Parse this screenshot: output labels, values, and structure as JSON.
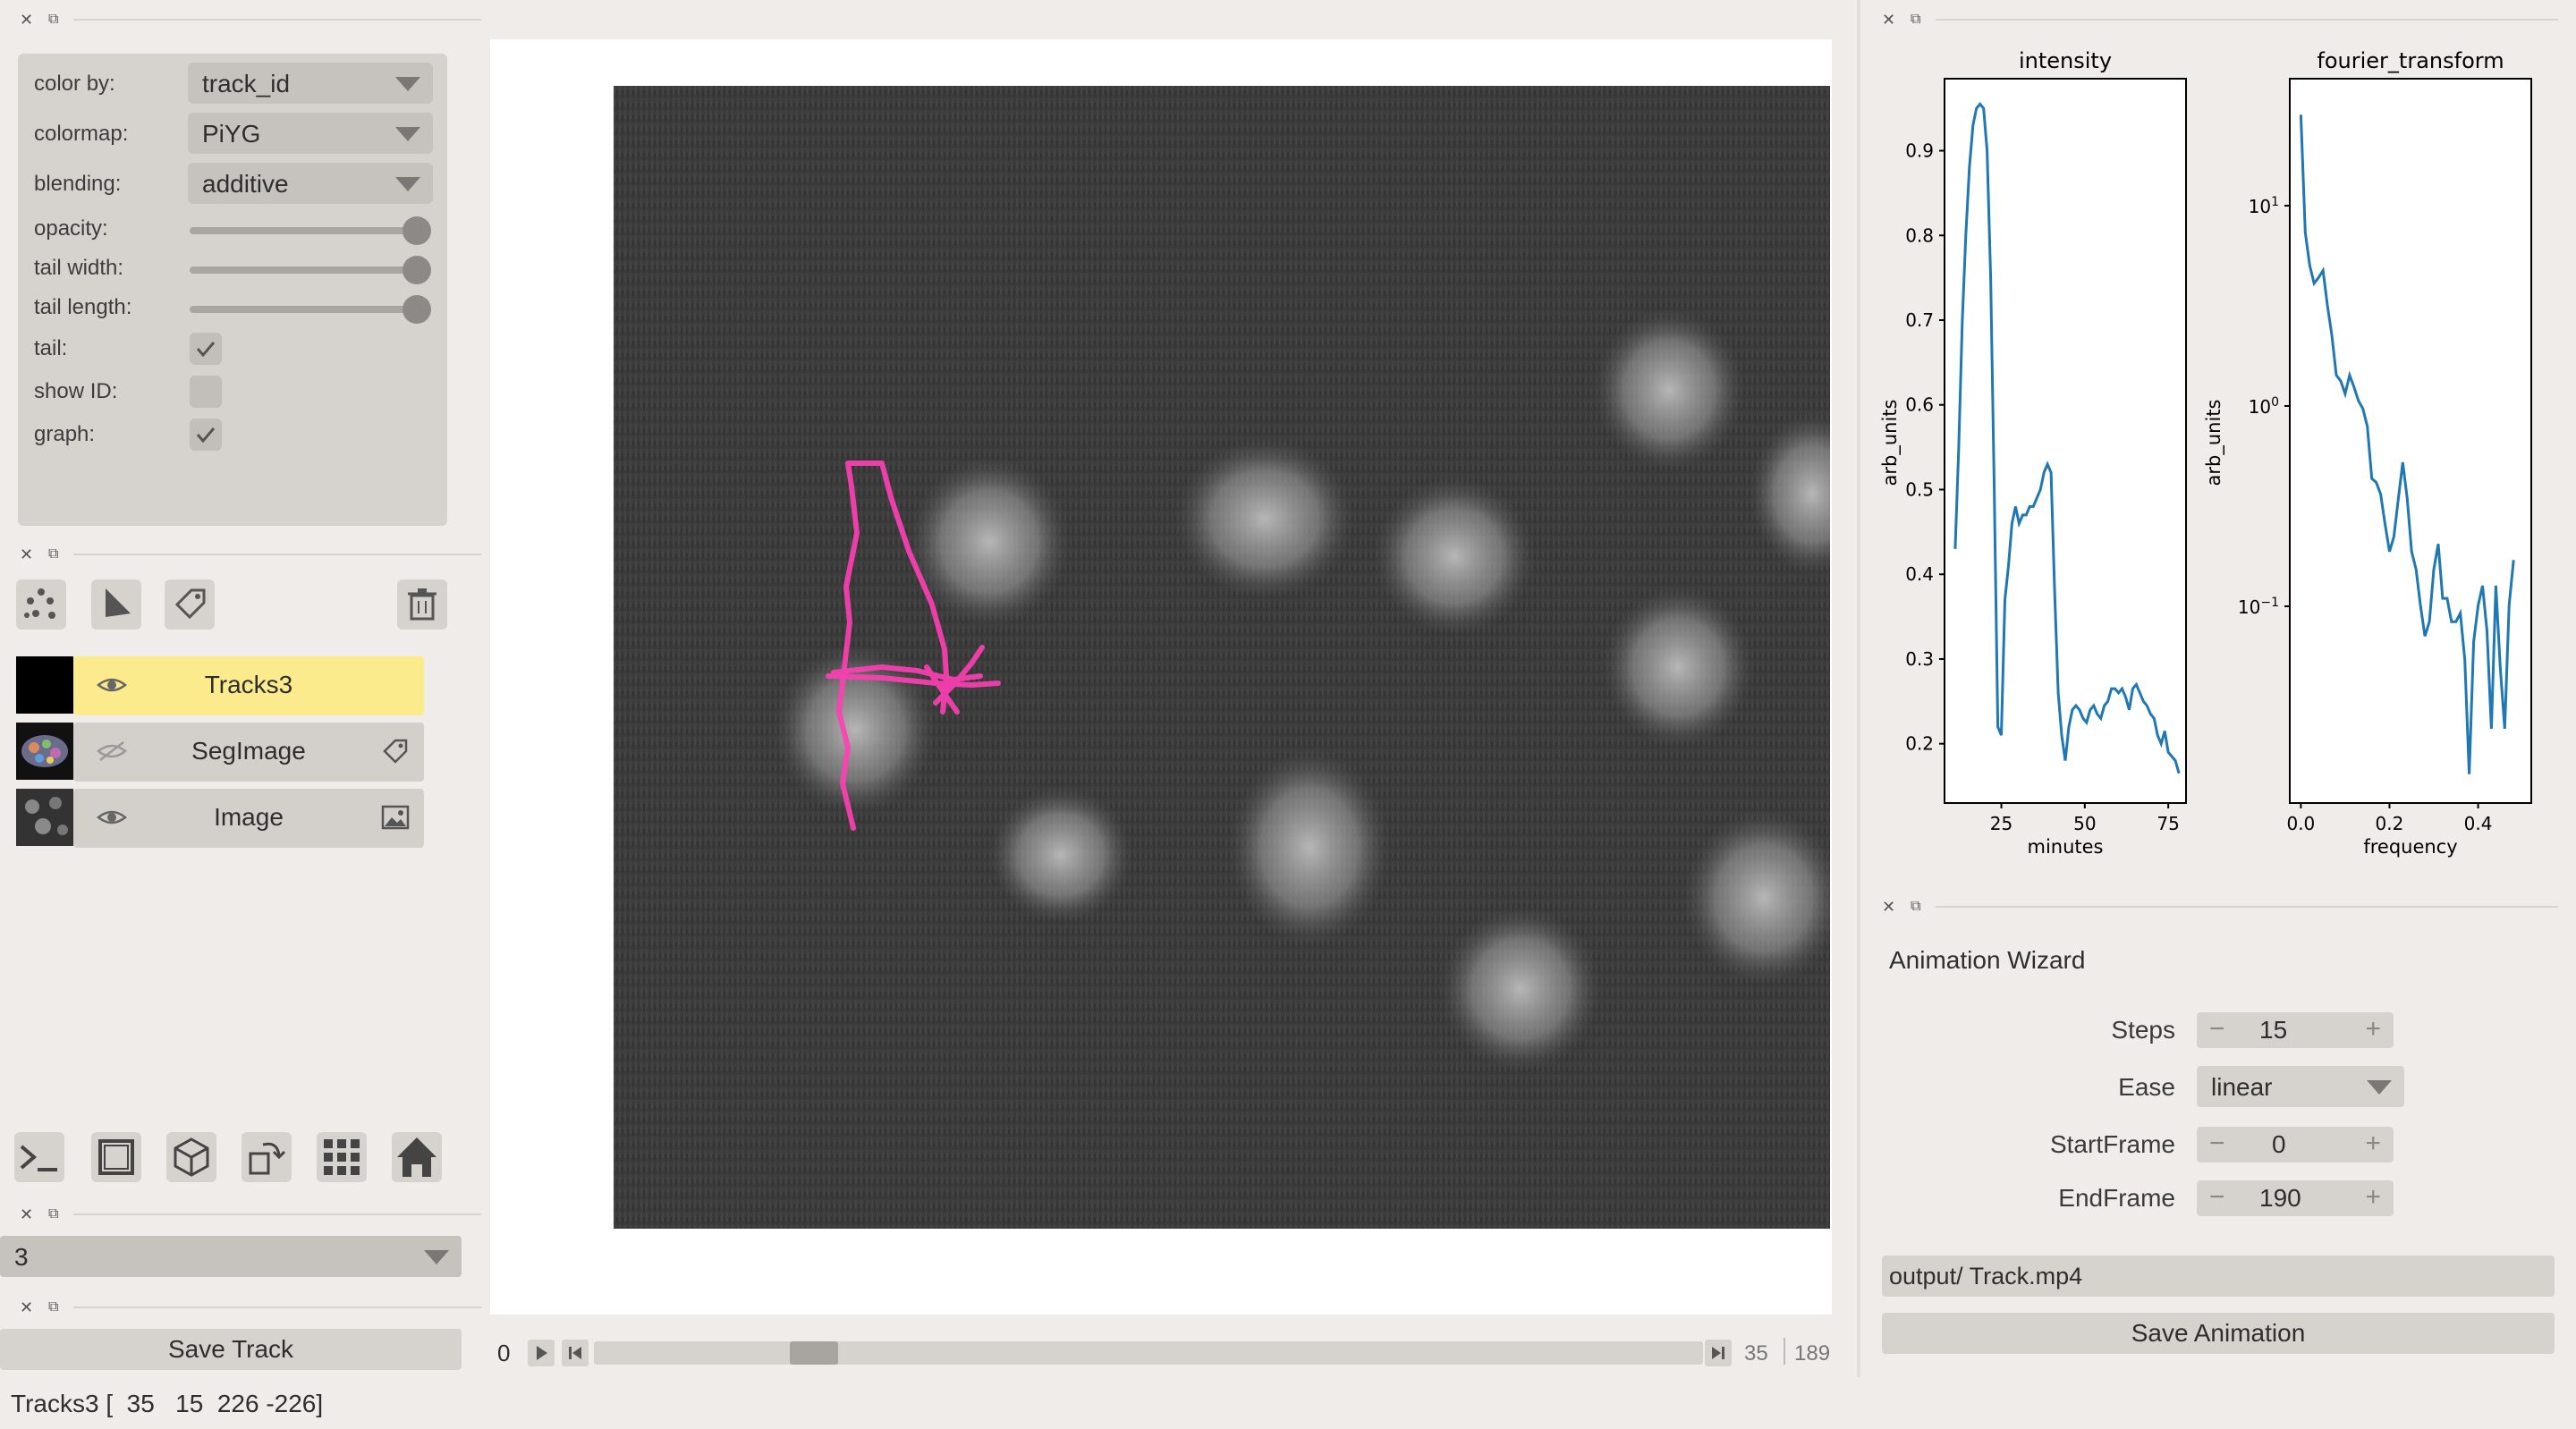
{
  "layer_controls": {
    "color_by": {
      "label": "color by:",
      "value": "track_id"
    },
    "colormap": {
      "label": "colormap:",
      "value": "PiYG"
    },
    "blending": {
      "label": "blending:",
      "value": "additive"
    },
    "opacity": {
      "label": "opacity:",
      "value": 1.0
    },
    "tail_width": {
      "label": "tail width:",
      "value": 1.0
    },
    "tail_length": {
      "label": "tail length:",
      "value": 1.0
    },
    "tail": {
      "label": "tail:",
      "checked": true
    },
    "show_id": {
      "label": "show ID:",
      "checked": false
    },
    "graph": {
      "label": "graph:",
      "checked": true
    }
  },
  "layers": [
    {
      "name": "Tracks3",
      "visible": true,
      "selected": true,
      "type_icon": ""
    },
    {
      "name": "SegImage",
      "visible": false,
      "selected": false,
      "type_icon": "label-icon"
    },
    {
      "name": "Image",
      "visible": true,
      "selected": false,
      "type_icon": "image-icon"
    }
  ],
  "track_select": {
    "value": "3"
  },
  "save_track": {
    "label": "Save Track"
  },
  "status_bar": {
    "text": "Tracks3 [  35   15  226 -226]"
  },
  "dims_slider": {
    "axis": "0",
    "current": "35",
    "max": "189",
    "position": 0.185
  },
  "plots": {
    "intensity": {
      "title": "intensity",
      "xlabel": "minutes",
      "ylabel": "arb_units",
      "yticks": [
        "0.2",
        "0.3",
        "0.4",
        "0.5",
        "0.6",
        "0.7",
        "0.8",
        "0.9"
      ],
      "xticks": [
        "25",
        "50",
        "75"
      ]
    },
    "fourier": {
      "title": "fourier_transform",
      "xlabel": "frequency",
      "ylabel": "arb_units",
      "xticks": [
        "0.0",
        "0.2",
        "0.4"
      ]
    }
  },
  "animation_wizard": {
    "title": "Animation Wizard",
    "steps": {
      "label": "Steps",
      "value": "15"
    },
    "ease": {
      "label": "Ease",
      "value": "linear"
    },
    "start_frame": {
      "label": "StartFrame",
      "value": "0"
    },
    "end_frame": {
      "label": "EndFrame",
      "value": "190"
    },
    "output_path": "output/ Track.mp4",
    "save_label": "Save Animation"
  },
  "colors": {
    "selected_layer": "#fbeb8d",
    "track": "#ff3fb5",
    "plot_line": "#1f77b4"
  }
}
